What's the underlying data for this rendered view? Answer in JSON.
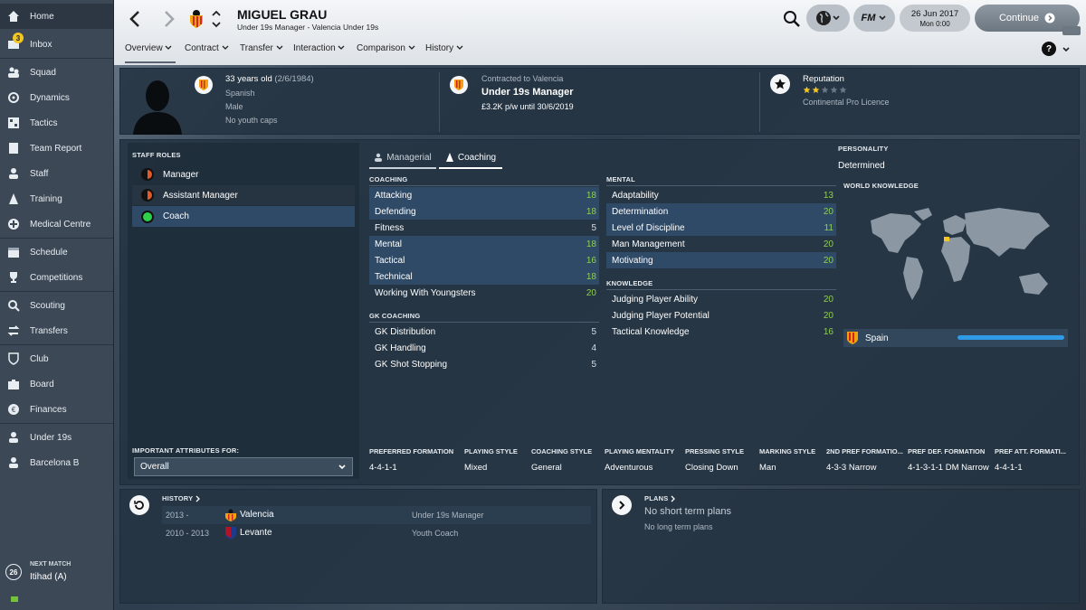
{
  "sidebar": {
    "items": [
      {
        "label": "Home",
        "icon": "home-icon"
      },
      {
        "label": "Inbox",
        "icon": "inbox-icon",
        "badge": "3"
      },
      {
        "label": "Squad",
        "icon": "squad-icon"
      },
      {
        "label": "Dynamics",
        "icon": "dynamics-icon"
      },
      {
        "label": "Tactics",
        "icon": "tactics-icon"
      },
      {
        "label": "Team Report",
        "icon": "team-report-icon"
      },
      {
        "label": "Staff",
        "icon": "staff-icon"
      },
      {
        "label": "Training",
        "icon": "training-icon"
      },
      {
        "label": "Medical Centre",
        "icon": "medical-icon"
      },
      {
        "label": "Schedule",
        "icon": "schedule-icon"
      },
      {
        "label": "Competitions",
        "icon": "trophy-icon"
      },
      {
        "label": "Scouting",
        "icon": "scouting-icon"
      },
      {
        "label": "Transfers",
        "icon": "transfers-icon"
      },
      {
        "label": "Club",
        "icon": "club-icon"
      },
      {
        "label": "Board",
        "icon": "board-icon"
      },
      {
        "label": "Finances",
        "icon": "finances-icon"
      },
      {
        "label": "Under 19s",
        "icon": "team-icon"
      },
      {
        "label": "Barcelona B",
        "icon": "team-icon"
      }
    ],
    "next_match": {
      "label": "NEXT MATCH",
      "day": "26",
      "opponent": "Itihad (A)"
    }
  },
  "header": {
    "name": "MIGUEL GRAU",
    "subtitle": "Under 19s Manager - Valencia Under 19s",
    "date": "26 Jun 2017",
    "time": "Mon 0:00",
    "continue_label": "Continue",
    "fm_label": "FM",
    "help_label": "?",
    "tabs": [
      "Overview",
      "Contract",
      "Transfer",
      "Interaction",
      "Comparison",
      "History"
    ]
  },
  "profile": {
    "age": "33 years old",
    "dob": "(2/6/1984)",
    "nationality": "Spanish",
    "gender": "Male",
    "caps": "No youth caps",
    "contract_label": "Contracted to Valencia",
    "role": "Under 19s Manager",
    "wage": "£3.2K p/w until 30/6/2019",
    "reputation_label": "Reputation",
    "reputation_stars": 2,
    "licence": "Continental Pro Licence"
  },
  "staff_roles": {
    "title": "STAFF ROLES",
    "roles": [
      {
        "label": "Manager",
        "color": "#e05a2b"
      },
      {
        "label": "Assistant Manager",
        "color": "#e05a2b"
      },
      {
        "label": "Coach",
        "color": "#2fd14a"
      }
    ],
    "important_label": "IMPORTANT ATTRIBUTES FOR:",
    "important_value": "Overall"
  },
  "attr_tabs": [
    "Managerial",
    "Coaching"
  ],
  "coaching": {
    "title": "COACHING",
    "items": [
      {
        "name": "Attacking",
        "value": "18"
      },
      {
        "name": "Defending",
        "value": "18"
      },
      {
        "name": "Fitness",
        "value": "5"
      },
      {
        "name": "Mental",
        "value": "18"
      },
      {
        "name": "Tactical",
        "value": "16"
      },
      {
        "name": "Technical",
        "value": "18"
      },
      {
        "name": "Working With Youngsters",
        "value": "20"
      }
    ]
  },
  "gk_coaching": {
    "title": "GK COACHING",
    "items": [
      {
        "name": "GK Distribution",
        "value": "5"
      },
      {
        "name": "GK Handling",
        "value": "4"
      },
      {
        "name": "GK Shot Stopping",
        "value": "5"
      }
    ]
  },
  "mental": {
    "title": "MENTAL",
    "items": [
      {
        "name": "Adaptability",
        "value": "13"
      },
      {
        "name": "Determination",
        "value": "20"
      },
      {
        "name": "Level of Discipline",
        "value": "11"
      },
      {
        "name": "Man Management",
        "value": "20"
      },
      {
        "name": "Motivating",
        "value": "20"
      }
    ]
  },
  "knowledge": {
    "title": "KNOWLEDGE",
    "items": [
      {
        "name": "Judging Player Ability",
        "value": "20"
      },
      {
        "name": "Judging Player Potential",
        "value": "20"
      },
      {
        "name": "Tactical Knowledge",
        "value": "16"
      }
    ]
  },
  "personality": {
    "title": "PERSONALITY",
    "value": "Determined"
  },
  "world_knowledge": {
    "title": "WORLD KNOWLEDGE",
    "country": "Spain",
    "level": 1.0
  },
  "styles": {
    "headers": [
      "PREFERRED FORMATION",
      "PLAYING STYLE",
      "COACHING STYLE",
      "PLAYING MENTALITY",
      "PRESSING STYLE",
      "MARKING STYLE",
      "2ND PREF FORMATIO...",
      "PREF DEF. FORMATION",
      "PREF ATT. FORMATI..."
    ],
    "values": [
      "4-4-1-1",
      "Mixed",
      "General",
      "Adventurous",
      "Closing Down",
      "Man",
      "4-3-3 Narrow",
      "4-1-3-1-1 DM Narrow",
      "4-4-1-1"
    ]
  },
  "history": {
    "title": "HISTORY",
    "rows": [
      {
        "years": "2013 -",
        "club": "Valencia",
        "role": "Under 19s Manager"
      },
      {
        "years": "2010 - 2013",
        "club": "Levante",
        "role": "Youth Coach"
      }
    ]
  },
  "plans": {
    "title": "PLANS",
    "short": "No short term plans",
    "long": "No long term plans"
  },
  "colors": {
    "accent": "#2f9ae6",
    "green_value": "#8ed04a",
    "highlight_row": "#2f4a66",
    "sidebar": "#3c4856"
  }
}
